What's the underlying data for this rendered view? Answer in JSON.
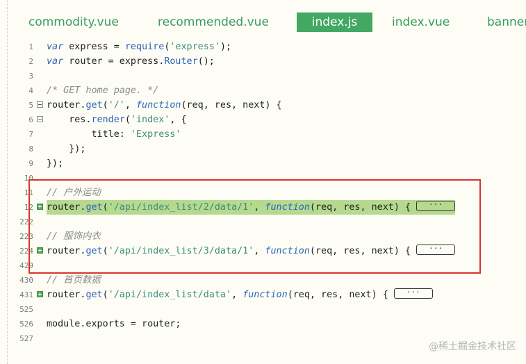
{
  "tabs": [
    {
      "label": "commodity.vue",
      "active": false
    },
    {
      "label": "recommended.vue",
      "active": false
    },
    {
      "label": "index.js",
      "active": true
    },
    {
      "label": "index.vue",
      "active": false
    },
    {
      "label": "banner",
      "active": false
    }
  ],
  "editor": {
    "lines": [
      {
        "num": "1",
        "fold": null,
        "tokens": [
          [
            "k",
            "var"
          ],
          [
            "p",
            " express = "
          ],
          [
            "fn",
            "require"
          ],
          [
            "p",
            "("
          ],
          [
            "s",
            "'express'"
          ],
          [
            "p",
            ");"
          ]
        ]
      },
      {
        "num": "2",
        "fold": null,
        "tokens": [
          [
            "k",
            "var"
          ],
          [
            "p",
            " router = express."
          ],
          [
            "fn",
            "Router"
          ],
          [
            "p",
            "();"
          ]
        ]
      },
      {
        "num": "3",
        "fold": null,
        "tokens": []
      },
      {
        "num": "4",
        "fold": null,
        "tokens": [
          [
            "c",
            "/* GET home page. */"
          ]
        ]
      },
      {
        "num": "5",
        "fold": "minus",
        "tokens": [
          [
            "p",
            "router."
          ],
          [
            "fn",
            "get"
          ],
          [
            "p",
            "("
          ],
          [
            "s",
            "'/'"
          ],
          [
            "p",
            ", "
          ],
          [
            "k",
            "function"
          ],
          [
            "p",
            "(req, res, next) {"
          ]
        ]
      },
      {
        "num": "6",
        "fold": "minus",
        "tokens": [
          [
            "p",
            "    res."
          ],
          [
            "fn",
            "render"
          ],
          [
            "p",
            "("
          ],
          [
            "s",
            "'index'"
          ],
          [
            "p",
            ", {"
          ]
        ]
      },
      {
        "num": "7",
        "fold": null,
        "tokens": [
          [
            "p",
            "        title: "
          ],
          [
            "s",
            "'Express'"
          ]
        ]
      },
      {
        "num": "8",
        "fold": null,
        "tokens": [
          [
            "p",
            "    });"
          ]
        ]
      },
      {
        "num": "9",
        "fold": null,
        "tokens": [
          [
            "p",
            "});"
          ]
        ]
      },
      {
        "num": "10",
        "fold": null,
        "tokens": []
      },
      {
        "num": "11",
        "fold": null,
        "tokens": [
          [
            "c",
            "// 户外运动"
          ]
        ]
      },
      {
        "num": "12",
        "fold": "plus",
        "highlight": true,
        "ellipsis": "···",
        "tokens": [
          [
            "p",
            "router."
          ],
          [
            "fn",
            "get"
          ],
          [
            "p",
            "("
          ],
          [
            "s",
            "'/api/index_list/2/data/1'"
          ],
          [
            "p",
            ", "
          ],
          [
            "k",
            "function"
          ],
          [
            "p",
            "(req, res, next) { "
          ]
        ]
      },
      {
        "num": "222",
        "fold": null,
        "tokens": []
      },
      {
        "num": "223",
        "fold": null,
        "tokens": [
          [
            "c",
            "// 服饰内衣"
          ]
        ]
      },
      {
        "num": "224",
        "fold": "plus",
        "ellipsis": "···",
        "tokens": [
          [
            "p",
            "router."
          ],
          [
            "fn",
            "get"
          ],
          [
            "p",
            "("
          ],
          [
            "s",
            "'/api/index_list/3/data/1'"
          ],
          [
            "p",
            ", "
          ],
          [
            "k",
            "function"
          ],
          [
            "p",
            "(req, res, next) { "
          ]
        ]
      },
      {
        "num": "429",
        "fold": null,
        "tokens": []
      },
      {
        "num": "430",
        "fold": null,
        "tokens": [
          [
            "c",
            "// 首页数据"
          ]
        ]
      },
      {
        "num": "431",
        "fold": "plus",
        "ellipsis": "···",
        "tokens": [
          [
            "p",
            "router."
          ],
          [
            "fn",
            "get"
          ],
          [
            "p",
            "("
          ],
          [
            "s",
            "'/api/index_list/data'"
          ],
          [
            "p",
            ", "
          ],
          [
            "k",
            "function"
          ],
          [
            "p",
            "(req, res, next) { "
          ]
        ]
      },
      {
        "num": "525",
        "fold": null,
        "tokens": []
      },
      {
        "num": "526",
        "fold": null,
        "tokens": [
          [
            "p",
            "module.exports = router;"
          ]
        ]
      },
      {
        "num": "527",
        "fold": null,
        "tokens": []
      }
    ]
  },
  "watermark": "@稀土掘金技术社区",
  "colors": {
    "accent": "#42a863",
    "highlight": "#b5d98f",
    "annotation_box": "#d9342b"
  }
}
